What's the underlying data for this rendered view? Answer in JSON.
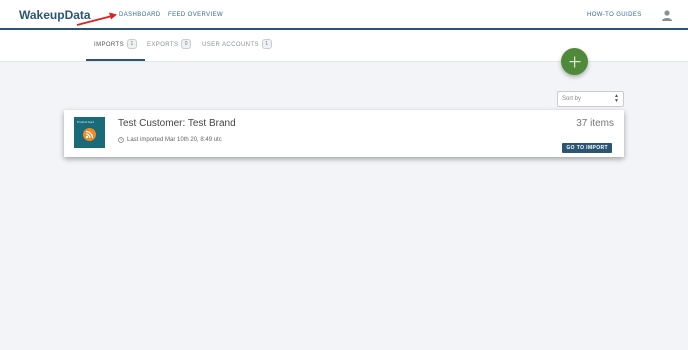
{
  "header": {
    "logo": "WakeupData",
    "nav": {
      "dashboard": "DASHBOARD",
      "feed_overview": "FEED OVERVIEW",
      "how_to": "HOW-TO GUIDES"
    }
  },
  "tabs": [
    {
      "label": "IMPORTS",
      "count": "1"
    },
    {
      "label": "EXPORTS",
      "count": "0"
    },
    {
      "label": "USER ACCOUNTS",
      "count": "1"
    }
  ],
  "sort": {
    "selected": "Sort by"
  },
  "feeds": [
    {
      "thumb_caption": "Product feed",
      "title": "Test Customer: Test Brand",
      "last_imported": "Last imported Mar 10th 20, 8:49 utc",
      "items": "37 items",
      "button": "GO TO IMPORT"
    }
  ],
  "colors": {
    "brand": "#2a5673",
    "add": "#4f8a3a",
    "annotation_arrow": "#e02020",
    "rss": "#f08a24"
  }
}
